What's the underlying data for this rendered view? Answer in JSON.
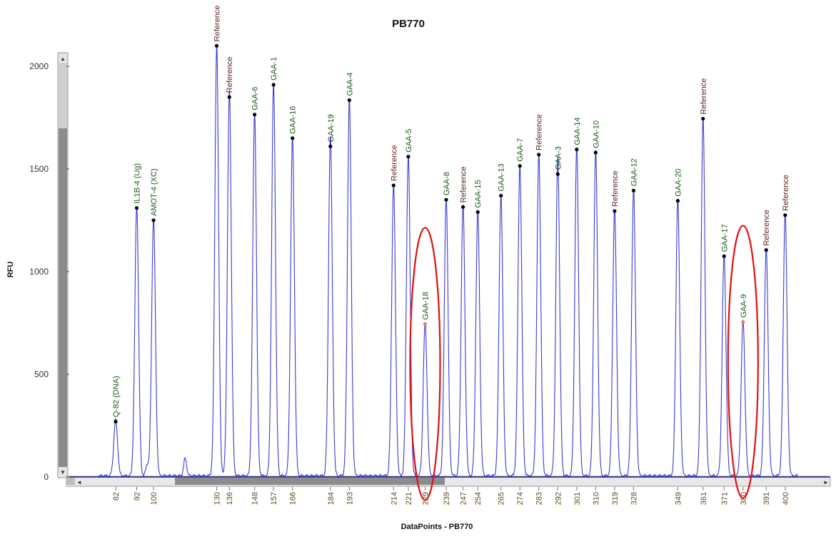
{
  "chart_data": {
    "type": "line",
    "title": "PB770",
    "xlabel": "DataPoints - PB770",
    "ylabel": "RFU",
    "ylim": [
      0,
      2100
    ],
    "yticks": [
      0,
      500,
      1000,
      1500,
      2000
    ],
    "xticks": [
      82,
      92,
      100,
      130,
      136,
      148,
      157,
      166,
      184,
      193,
      214,
      221,
      229,
      239,
      247,
      254,
      265,
      274,
      283,
      292,
      301,
      310,
      319,
      328,
      349,
      361,
      371,
      380,
      391,
      400
    ],
    "grid": false,
    "line_color": "#3b3bd6",
    "highlight_color": "#e01010",
    "peaks": [
      {
        "x": 82,
        "y": 270,
        "label": "Q-82 (DNA)"
      },
      {
        "x": 92,
        "y": 1310,
        "label": "IL1B-4 (Ug)"
      },
      {
        "x": 100,
        "y": 1250,
        "label": "AMOT-4 (XC)"
      },
      {
        "x": 130,
        "y": 2100,
        "label": "Reference"
      },
      {
        "x": 136,
        "y": 1850,
        "label": "Reference"
      },
      {
        "x": 148,
        "y": 1765,
        "label": "GAA-6"
      },
      {
        "x": 157,
        "y": 1910,
        "label": "GAA-1"
      },
      {
        "x": 166,
        "y": 1650,
        "label": "GAA-16"
      },
      {
        "x": 184,
        "y": 1610,
        "label": "GAA-19"
      },
      {
        "x": 193,
        "y": 1835,
        "label": "GAA-4"
      },
      {
        "x": 214,
        "y": 1420,
        "label": "Reference"
      },
      {
        "x": 221,
        "y": 1560,
        "label": "GAA-5"
      },
      {
        "x": 229,
        "y": 745,
        "label": "GAA-18",
        "highlight": true
      },
      {
        "x": 239,
        "y": 1350,
        "label": "GAA-8"
      },
      {
        "x": 247,
        "y": 1315,
        "label": "Reference"
      },
      {
        "x": 254,
        "y": 1290,
        "label": "GAA-15"
      },
      {
        "x": 265,
        "y": 1370,
        "label": "GAA-13"
      },
      {
        "x": 274,
        "y": 1515,
        "label": "GAA-7"
      },
      {
        "x": 283,
        "y": 1570,
        "label": "Reference"
      },
      {
        "x": 292,
        "y": 1475,
        "label": "GAA-3"
      },
      {
        "x": 301,
        "y": 1595,
        "label": "GAA-14"
      },
      {
        "x": 310,
        "y": 1580,
        "label": "GAA-10"
      },
      {
        "x": 319,
        "y": 1295,
        "label": "Reference"
      },
      {
        "x": 328,
        "y": 1395,
        "label": "GAA-12"
      },
      {
        "x": 349,
        "y": 1345,
        "label": "GAA-20"
      },
      {
        "x": 361,
        "y": 1745,
        "label": "Reference"
      },
      {
        "x": 371,
        "y": 1075,
        "label": "GAA-17"
      },
      {
        "x": 380,
        "y": 755,
        "label": "GAA-9",
        "highlight": true
      },
      {
        "x": 391,
        "y": 1105,
        "label": "Reference"
      },
      {
        "x": 400,
        "y": 1275,
        "label": "Reference"
      }
    ],
    "minor_peaks": [
      {
        "x": 97,
        "y": 55
      },
      {
        "x": 115,
        "y": 85
      },
      {
        "x": 137,
        "y": 60
      },
      {
        "x": 184,
        "y": 45
      },
      {
        "x": 292,
        "y": 75
      }
    ]
  }
}
